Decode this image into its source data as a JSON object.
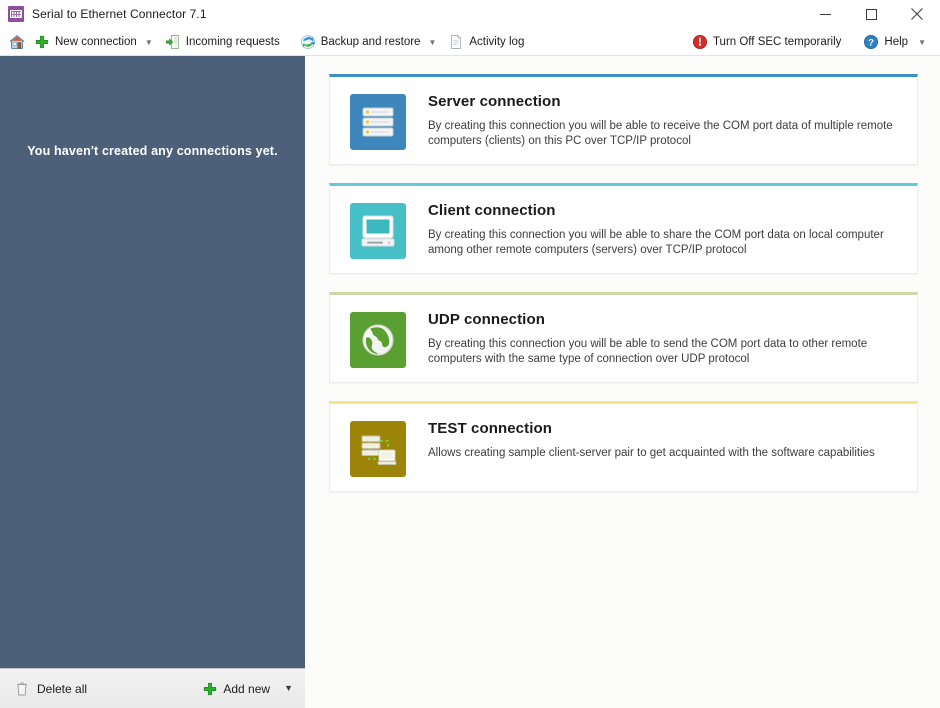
{
  "window": {
    "title": "Serial to Ethernet Connector 7.1",
    "app_icon": "serial-connector-icon",
    "controls": {
      "minimize": "minimize-icon",
      "maximize": "maximize-icon",
      "close": "close-icon"
    }
  },
  "toolbar": {
    "home_icon": "home-icon",
    "items": [
      {
        "label": "New connection",
        "icon": "plus-icon",
        "has_caret": true
      },
      {
        "label": "Incoming requests",
        "icon": "incoming-requests-icon",
        "has_caret": false
      },
      {
        "label": "Backup and restore",
        "icon": "backup-restore-icon",
        "has_caret": true
      },
      {
        "label": "Activity log",
        "icon": "activity-log-icon",
        "has_caret": false
      }
    ],
    "right_items": [
      {
        "label": "Turn Off SEC temporarily",
        "icon": "power-off-icon",
        "has_caret": false
      },
      {
        "label": "Help",
        "icon": "help-icon",
        "has_caret": true
      }
    ],
    "caret_glyph": "▼"
  },
  "sidebar": {
    "empty_message": "You haven't created any connections yet.",
    "footer": {
      "delete_all_label": "Delete all",
      "delete_all_icon": "trash-icon",
      "add_new_label": "Add new",
      "add_new_icon": "plus-icon",
      "add_new_caret": "▼"
    }
  },
  "colors": {
    "sidebar_bg": "#4c6079",
    "content_bg": "#fcfcfb",
    "server_accent": "#3b8fc4",
    "client_accent": "#63cbd4",
    "udp_accent": "#cdd9a4",
    "test_accent": "#f2e58e",
    "server_icon_bg": "#3d87bd",
    "client_icon_bg": "#47bfc6",
    "udp_icon_bg": "#5a9f31",
    "test_icon_bg": "#9b8407",
    "add_new_green": "#2eae2e",
    "power_red": "#d42b2b"
  },
  "cards": [
    {
      "key": "server",
      "title": "Server connection",
      "description": "By creating this connection you will be able to receive the COM port data of multiple remote computers (clients) on this PC over TCP/IP protocol",
      "icon": "server-stack-icon"
    },
    {
      "key": "client",
      "title": "Client connection",
      "description": "By creating this connection you will be able to share the COM port data on local computer among other remote computers (servers) over TCP/IP protocol",
      "icon": "desktop-monitor-icon"
    },
    {
      "key": "udp",
      "title": "UDP connection",
      "description": "By creating this connection you will be able to send the COM port data to other remote computers with the same type of connection over UDP protocol",
      "icon": "globe-icon"
    },
    {
      "key": "test",
      "title": "TEST connection",
      "description": "Allows creating sample client-server pair to get acquainted with the software capabilities",
      "icon": "test-pair-icon"
    }
  ]
}
